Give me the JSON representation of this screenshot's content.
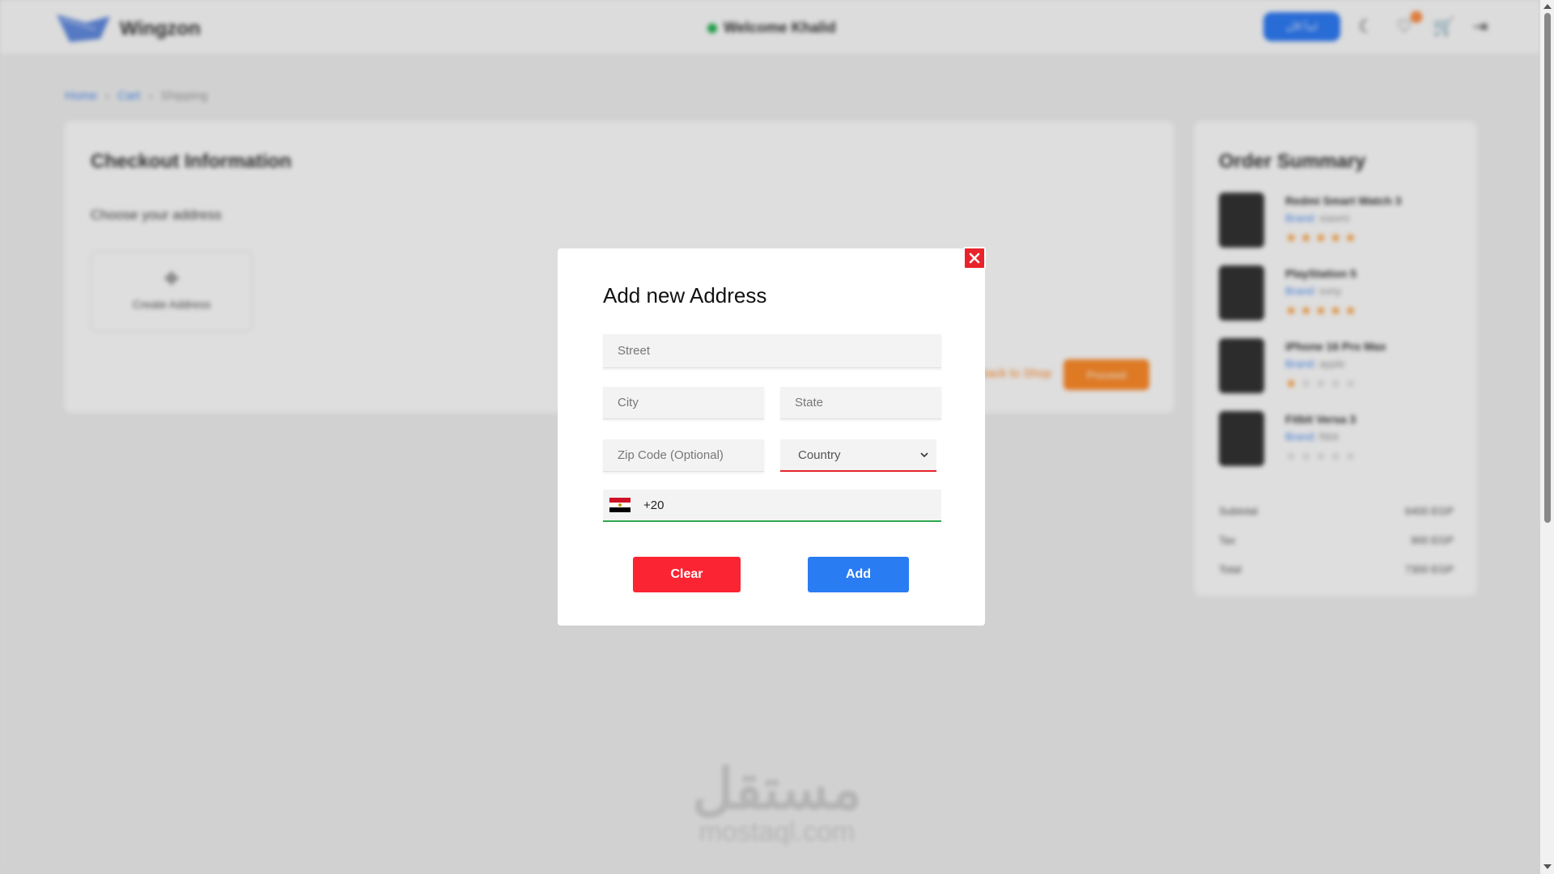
{
  "header": {
    "brand": "Wingzon",
    "welcome": "Welcome Khalid",
    "cta_label": "ابدأ الآن",
    "wishlist_count": "0"
  },
  "breadcrumb": [
    "Home",
    "Cart",
    "Shipping"
  ],
  "checkout": {
    "title": "Checkout Information",
    "subtitle": "Choose your address",
    "create_address": "Create Address",
    "back_link": "Back to Shop",
    "proceed_label": "Proceed"
  },
  "order_summary": {
    "title": "Order Summary",
    "items": [
      {
        "name": "Redmi Smart Watch 3",
        "brand_label": "Brand:",
        "brand": "xiaomi",
        "rating": 5
      },
      {
        "name": "PlayStation 5",
        "brand_label": "Brand:",
        "brand": "sony",
        "rating": 5
      },
      {
        "name": "iPhone 16 Pro Max",
        "brand_label": "Brand:",
        "brand": "apple",
        "rating": 1
      },
      {
        "name": "Fitbit Versa 3",
        "brand_label": "Brand:",
        "brand": "fitbit",
        "rating": 0
      }
    ],
    "subtotal_label": "Subtotal",
    "subtotal": "6400 EGP",
    "tax_label": "Tax",
    "tax": "900 EGP",
    "total_label": "Total",
    "total": "7300 EGP"
  },
  "modal": {
    "title": "Add new Address",
    "street_placeholder": "Street",
    "city_placeholder": "City",
    "state_placeholder": "State",
    "zip_placeholder": "Zip Code (Optional)",
    "country_selected": "Country",
    "phone_code": "+20",
    "clear_label": "Clear",
    "add_label": "Add"
  },
  "watermark": {
    "arabic": "مستقل",
    "latin": "mostaql.com"
  },
  "colors": {
    "primary_blue": "#2a7cf3",
    "danger_red": "#fb2432",
    "success_green": "#2fa84f",
    "accent_orange": "#ff8c2a"
  },
  "icons": [
    "moon-icon",
    "heart-icon",
    "cart-icon",
    "logout-icon",
    "close-icon",
    "chevron-down-icon",
    "egypt-flag-icon",
    "location-icon"
  ]
}
